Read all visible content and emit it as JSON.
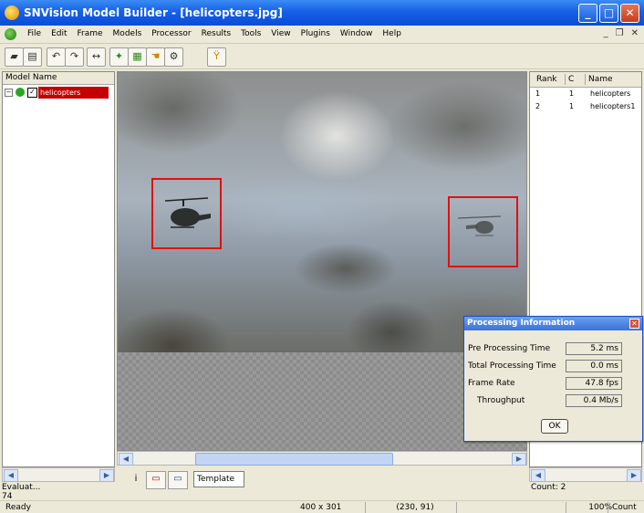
{
  "window": {
    "title": "SNVision Model Builder - [helicopters.jpg]"
  },
  "menu": {
    "items": [
      "File",
      "Edit",
      "Frame",
      "Models",
      "Processor",
      "Results",
      "Tools",
      "View",
      "Plugins",
      "Window",
      "Help"
    ]
  },
  "left_panel": {
    "header": "Model Name",
    "tree_item": "helicopters",
    "status_line1": "Evaluat...",
    "status_line2": "74"
  },
  "right_panel": {
    "headers": [
      "Rank",
      "C",
      "Name"
    ],
    "rows": [
      {
        "rank": "1",
        "c": "1",
        "name": "helicopters"
      },
      {
        "rank": "2",
        "c": "1",
        "name": "helicopters1"
      }
    ],
    "count": "Count: 2"
  },
  "bottom_toolbar": {
    "textbox_label": "Template"
  },
  "dialog": {
    "title": "Processing Information",
    "rows": [
      {
        "label": "Pre Processing Time",
        "value": "5.2 ms"
      },
      {
        "label": "Total Processing Time",
        "value": "0.0 ms"
      },
      {
        "label": "Frame Rate",
        "value": "47.8 fps"
      },
      {
        "label": "Throughput",
        "value": "0.4 Mb/s"
      }
    ],
    "ok_label": "OK"
  },
  "statusbar": {
    "ready": "Ready",
    "dimensions": "400 x 301",
    "coordinates": "(230, 91)",
    "zoom": "100%",
    "count": "Count"
  }
}
